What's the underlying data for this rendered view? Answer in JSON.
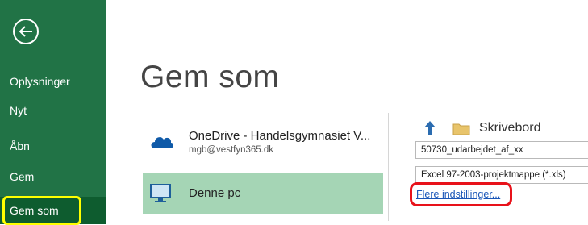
{
  "sidebar": {
    "items": [
      {
        "label": "Oplysninger"
      },
      {
        "label": "Nyt"
      },
      {
        "label": "Åbn"
      },
      {
        "label": "Gem"
      },
      {
        "label": "Gem som"
      }
    ]
  },
  "page": {
    "title": "Gem som"
  },
  "locations": [
    {
      "name": "OneDrive - Handelsgymnasiet V...",
      "account": "mgb@vestfyn365.dk",
      "icon": "onedrive-cloud-icon"
    },
    {
      "name": "Denne pc",
      "icon": "computer-monitor-icon",
      "selected": true
    }
  ],
  "save_panel": {
    "breadcrumb": "Skrivebord",
    "filename": "50730_udarbejdet_af_xx",
    "filetype": "Excel 97-2003-projektmappe (*.xls)",
    "more_options_link": "Flere indstillinger..."
  },
  "colors": {
    "sidebar_bg": "#217346",
    "selected_location_bg": "#a5d5b5",
    "annotation_yellow": "#ffff00",
    "annotation_red": "#e8121a"
  }
}
